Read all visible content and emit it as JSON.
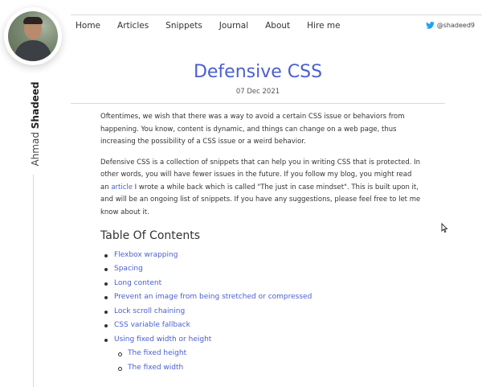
{
  "sidebar": {
    "first_name": "Ahmad",
    "last_name": "Shadeed"
  },
  "nav": {
    "items": [
      "Home",
      "Articles",
      "Snippets",
      "Journal",
      "About",
      "Hire me"
    ]
  },
  "twitter": {
    "handle": "@shadeed9",
    "icon": "twitter-bird-icon",
    "color": "#1da1f2"
  },
  "article": {
    "title": "Defensive CSS",
    "date": "07 Dec 2021",
    "accent_color": "#4a5fd0",
    "intro": "Oftentimes, we wish that there was a way to avoid a certain CSS issue or behaviors from happening. You know, content is dynamic, and things can change on a web page, thus increasing the possibility of a CSS issue or a weird behavior.",
    "para2_before": "Defensive CSS is a collection of snippets that can help you in writing CSS that is protected. In other words, you will have fewer issues in the future. If you follow my blog, you might read an ",
    "para2_link": "article",
    "para2_after": " I wrote a while back which is called \"The just in case mindset\". This is built upon it, and will be an ongoing list of snippets. If you have any suggestions, please feel free to let me know about it."
  },
  "toc": {
    "heading": "Table Of Contents",
    "items": [
      "Flexbox wrapping",
      "Spacing",
      "Long content",
      "Prevent an image from being stretched or compressed",
      "Lock scroll chaining",
      "CSS variable fallback",
      "Using fixed width or height"
    ],
    "subitems": [
      "The fixed height",
      "The fixed width"
    ]
  }
}
